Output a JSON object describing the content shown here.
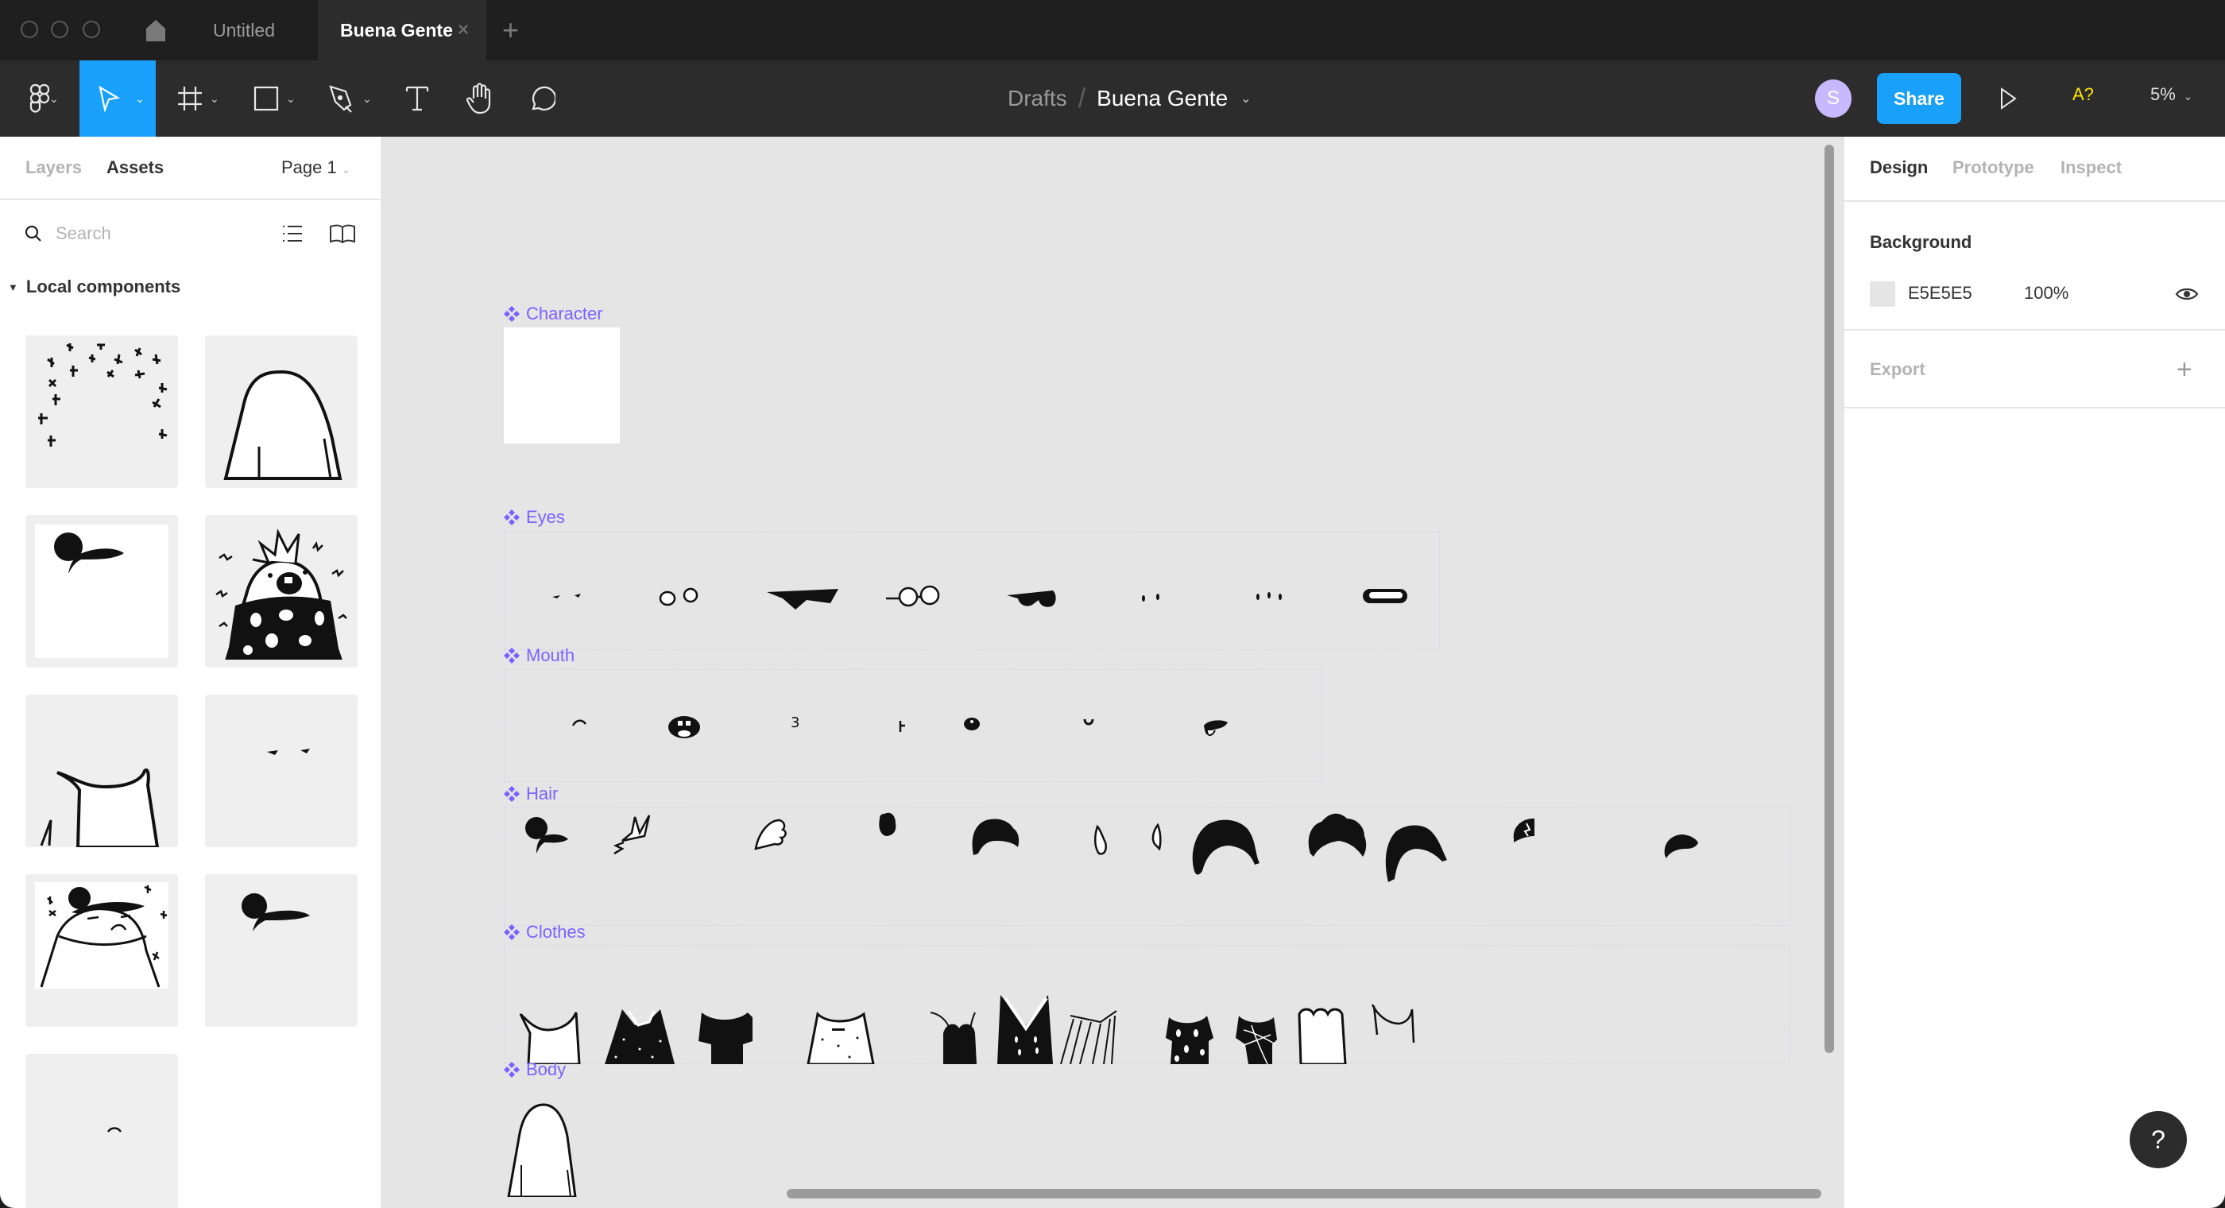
{
  "window": {
    "tabs": [
      {
        "label": "Untitled",
        "active": false
      },
      {
        "label": "Buena Gente",
        "active": true
      }
    ],
    "close_glyph": "×",
    "new_tab_glyph": "+"
  },
  "toolbar": {
    "tools": [
      "main-menu",
      "move",
      "frame",
      "shape",
      "pen",
      "text",
      "hand",
      "comment"
    ],
    "active_tool": "move",
    "breadcrumb": {
      "parent": "Drafts",
      "separator": "/",
      "file": "Buena Gente"
    },
    "avatar_initial": "S",
    "share_label": "Share",
    "a11y_label": "A?",
    "zoom_level": "5%",
    "accent_color": "#18a0fb",
    "avatar_color": "#c7b9ff"
  },
  "left_panel": {
    "tabs": [
      {
        "label": "Layers",
        "active": false
      },
      {
        "label": "Assets",
        "active": true
      }
    ],
    "page_selector": "Page 1",
    "search": {
      "placeholder": "Search",
      "value": ""
    },
    "section_title": "Local components",
    "components": [
      {
        "icon": "stars-component-thumbnail"
      },
      {
        "icon": "body-component-thumbnail"
      },
      {
        "icon": "hair-on-white-component-thumbnail"
      },
      {
        "icon": "punk-character-component-thumbnail"
      },
      {
        "icon": "clothes-component-thumbnail"
      },
      {
        "icon": "eyes-component-thumbnail"
      },
      {
        "icon": "character-with-stars-component-thumbnail"
      },
      {
        "icon": "hair-component-thumbnail"
      },
      {
        "icon": "mouth-component-thumbnail"
      }
    ]
  },
  "canvas": {
    "background": "#e5e5e5",
    "component_color": "#7b61ff",
    "frames": [
      {
        "name": "Character",
        "variants": 1
      },
      {
        "name": "Eyes",
        "variants": 8
      },
      {
        "name": "Mouth",
        "variants": 7
      },
      {
        "name": "Hair",
        "variants": 11
      },
      {
        "name": "Clothes",
        "variants": 11
      },
      {
        "name": "Body",
        "variants": 1
      }
    ]
  },
  "right_panel": {
    "tabs": [
      {
        "label": "Design",
        "active": true
      },
      {
        "label": "Prototype",
        "active": false
      },
      {
        "label": "Inspect",
        "active": false
      }
    ],
    "background": {
      "title": "Background",
      "hex": "E5E5E5",
      "opacity": "100%"
    },
    "export": {
      "title": "Export",
      "add_glyph": "+"
    }
  },
  "help": {
    "label": "?"
  }
}
